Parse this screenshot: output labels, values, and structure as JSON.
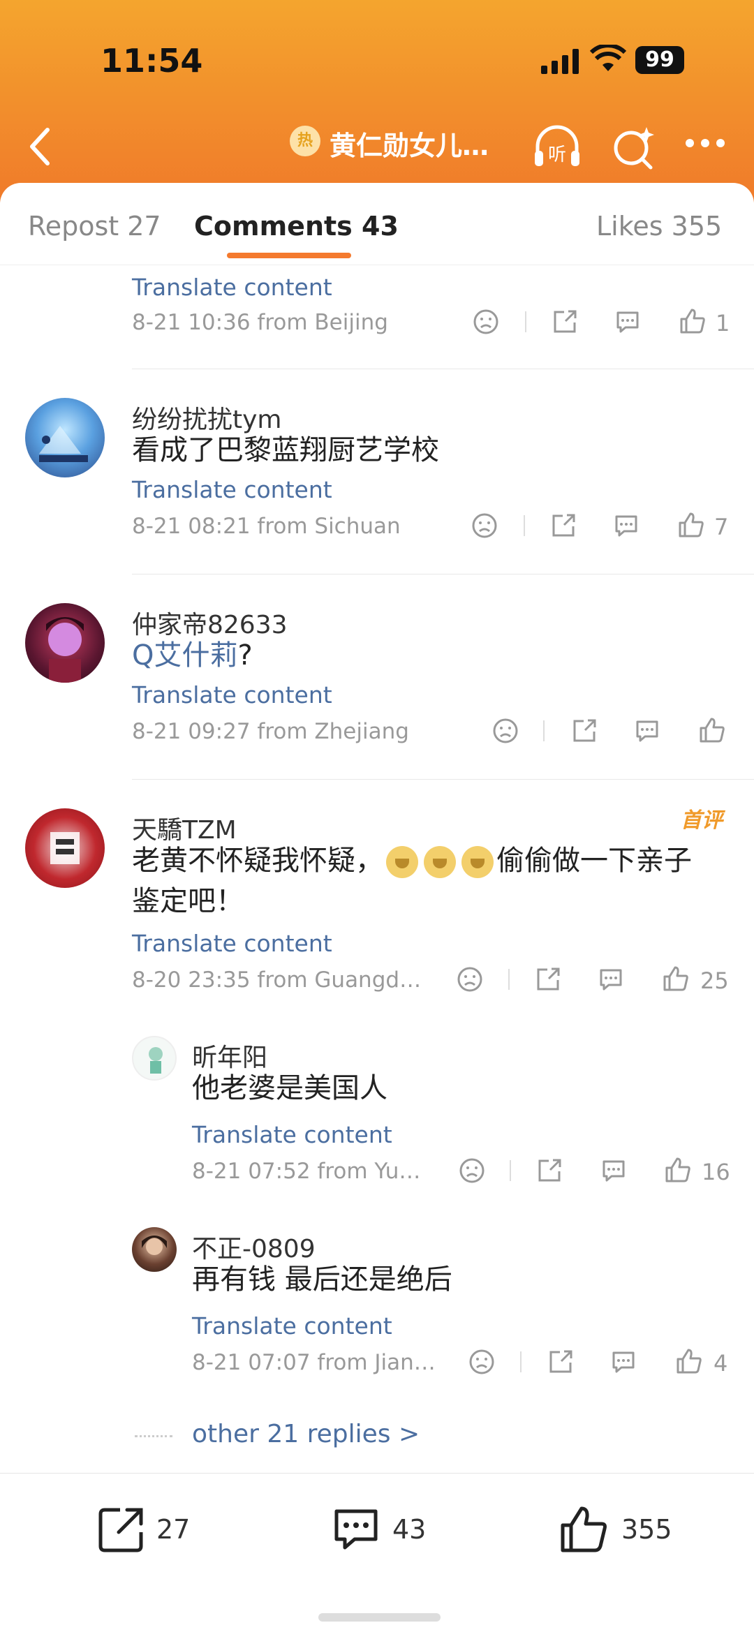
{
  "status_bar": {
    "time": "11:54",
    "battery": "99"
  },
  "nav": {
    "topic_badge": "热",
    "title": "黄仁勋女儿…"
  },
  "tabs": [
    {
      "label": "Repost",
      "count": "27"
    },
    {
      "label": "Comments",
      "count": "43"
    },
    {
      "label": "Likes",
      "count": "355"
    }
  ],
  "comments": [
    {
      "translate": "Translate content",
      "meta": "8-21 10:36  from Beijing",
      "likes": "1"
    },
    {
      "name": "纷纷扰扰tym",
      "text": "看成了巴黎蓝翔厨艺学校",
      "translate": "Translate content",
      "meta": "8-21 08:21  from Sichuan",
      "likes": "7"
    },
    {
      "name": "仲家帝82633",
      "text_link": "Q艾什莉",
      "text_after": "?",
      "translate": "Translate content",
      "meta": "8-21 09:27  from Zhejiang",
      "likes": ""
    },
    {
      "name": "天驕TZM",
      "badge": "首评",
      "text_line1": "老黄不怀疑我怀疑，",
      "text_line1b": "偷偷做一下亲子",
      "text_line2": "鉴定吧！",
      "translate": "Translate content",
      "meta": "8-20 23:35  from Guangd…",
      "likes": "25"
    }
  ],
  "replies": [
    {
      "name": "昕年阳",
      "text": "他老婆是美国人",
      "translate": "Translate content",
      "meta": "8-21 07:52  from Yu…",
      "likes": "16"
    },
    {
      "name": "不正-0809",
      "text": "再有钱  最后还是绝后",
      "translate": "Translate content",
      "meta": "8-21 07:07  from Jian…",
      "likes": "4"
    }
  ],
  "more_replies": "other 21 replies >",
  "bottom_bar": {
    "repost": "27",
    "comments": "43",
    "likes": "355"
  },
  "colors": {
    "accent": "#f47a2e",
    "link": "#4b6ea0"
  }
}
